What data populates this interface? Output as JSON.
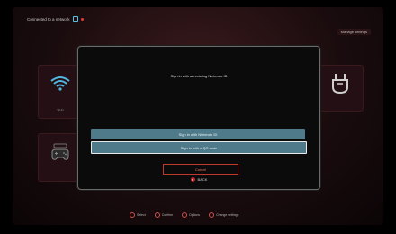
{
  "status_bar": {
    "text": "Connected to a network"
  },
  "top_right": {
    "label": "Manage settings"
  },
  "tiles": {
    "wifi_label": "Wi-Fi",
    "controller_label": "",
    "right_label": ""
  },
  "modal": {
    "title": "Sign in with an existing Nintendo ID",
    "option_1": "Sign in with Nintendo ID",
    "option_2": "Sign in with a QR code",
    "cancel": "Cancel",
    "back_label": "BACK",
    "back_button_glyph": "B"
  },
  "bottom_legend": [
    {
      "label": "Select"
    },
    {
      "label": "Confirm"
    },
    {
      "label": "Options"
    },
    {
      "label": "Change settings"
    }
  ],
  "colors": {
    "accent_button": "#4f7a8a",
    "cancel_border": "#c0392b",
    "background": "#1a0c0e"
  },
  "icons": {
    "wifi": "wifi-icon",
    "controller": "controller-icon",
    "usb": "usb-icon",
    "back_button": "b-button-icon"
  }
}
